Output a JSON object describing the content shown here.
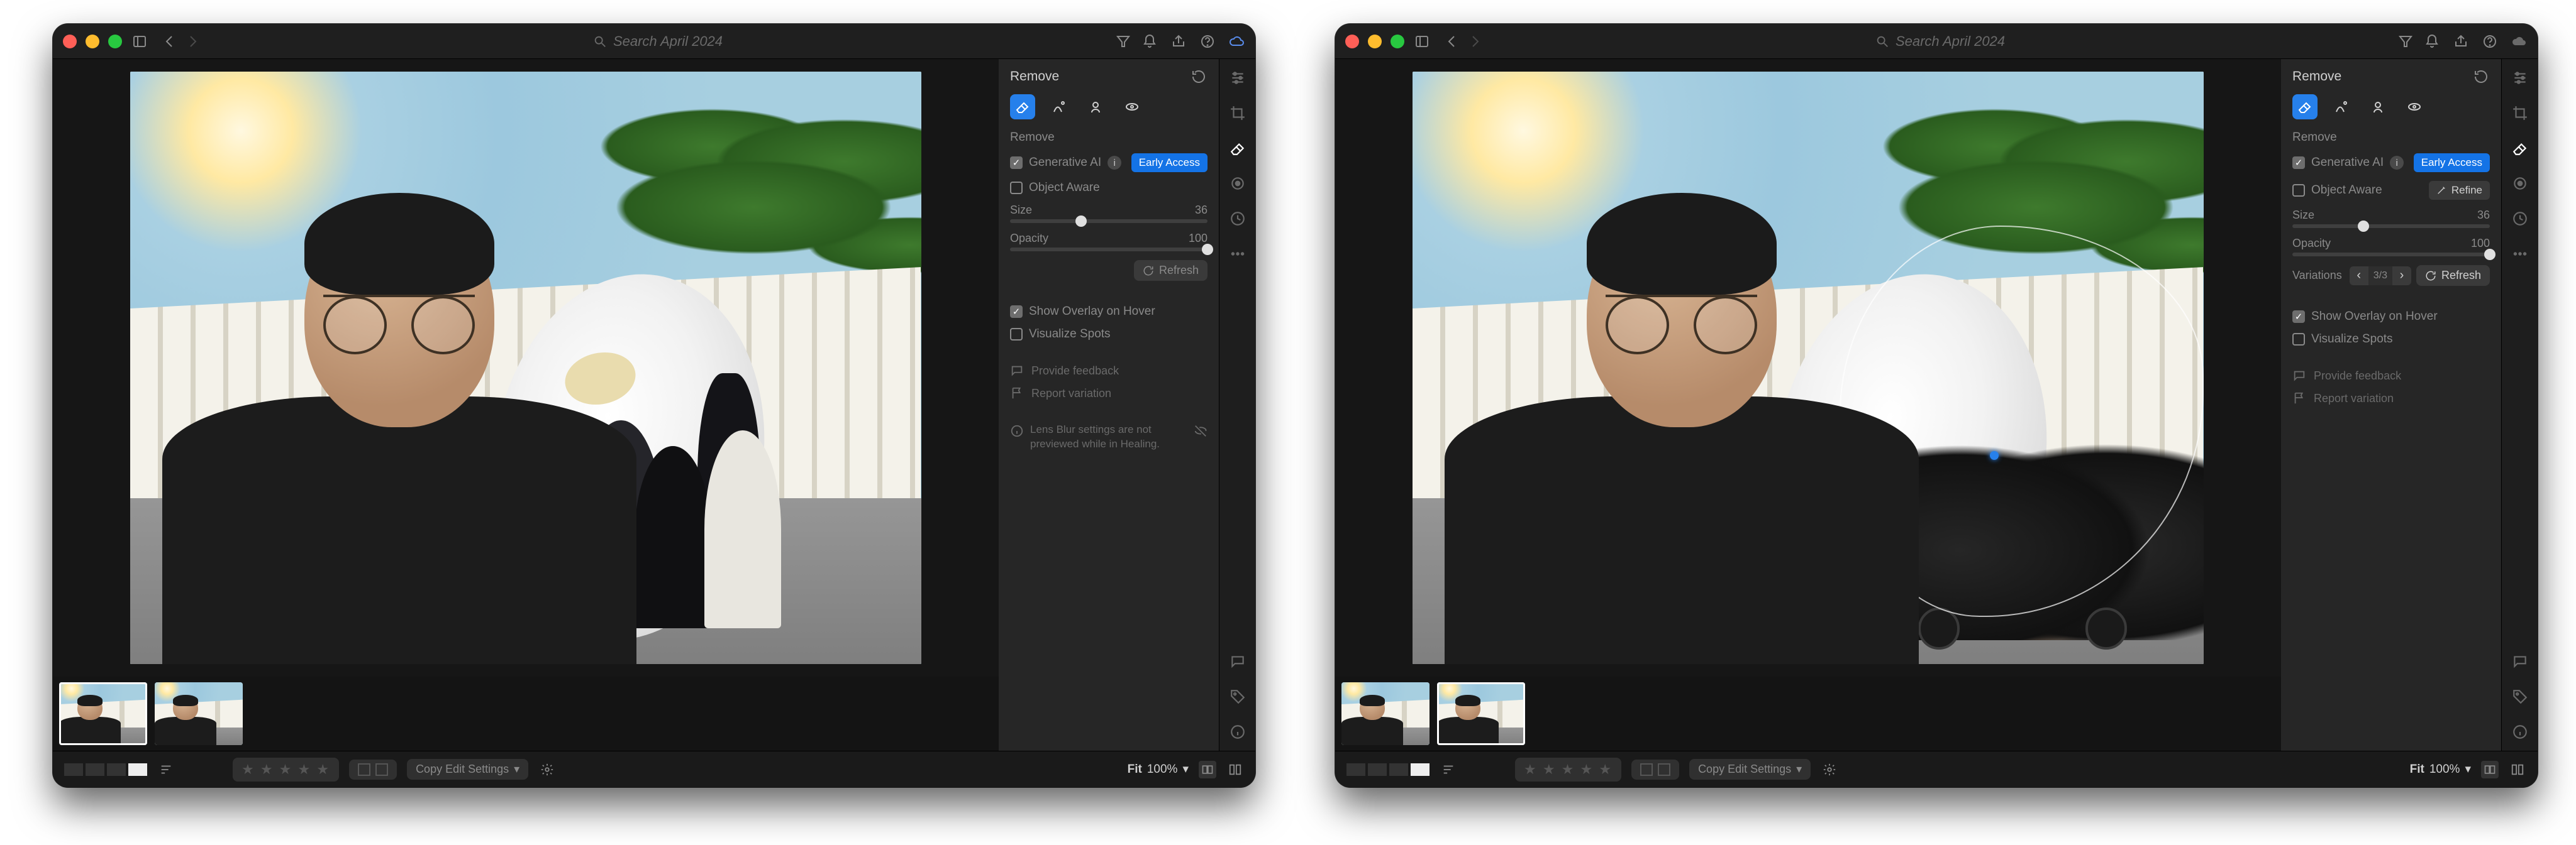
{
  "titlebar": {
    "search_placeholder": "Search April 2024"
  },
  "panel_left": {
    "title": "Remove",
    "subhead": "Remove",
    "gen_ai_label": "Generative AI",
    "early_access": "Early Access",
    "object_aware": "Object Aware",
    "size_label": "Size",
    "size_value": "36",
    "opacity_label": "Opacity",
    "opacity_value": "100",
    "refresh": "Refresh",
    "show_overlay": "Show Overlay on Hover",
    "visualize_spots": "Visualize Spots",
    "provide_feedback": "Provide feedback",
    "report_variation": "Report variation",
    "lens_notice": "Lens Blur settings are not previewed while in Healing."
  },
  "panel_right": {
    "title": "Remove",
    "subhead": "Remove",
    "gen_ai_label": "Generative AI",
    "early_access": "Early Access",
    "object_aware": "Object Aware",
    "refine": "Refine",
    "size_label": "Size",
    "size_value": "36",
    "opacity_label": "Opacity",
    "opacity_value": "100",
    "variations_label": "Variations",
    "variations_count": "3/3",
    "refresh": "Refresh",
    "show_overlay": "Show Overlay on Hover",
    "visualize_spots": "Visualize Spots",
    "provide_feedback": "Provide feedback",
    "report_variation": "Report variation"
  },
  "bottombar": {
    "copy_edit_settings": "Copy Edit Settings",
    "fit_label": "Fit",
    "zoom_value": "100%"
  },
  "sliders": {
    "size_pct": 36,
    "opacity_pct": 100
  }
}
